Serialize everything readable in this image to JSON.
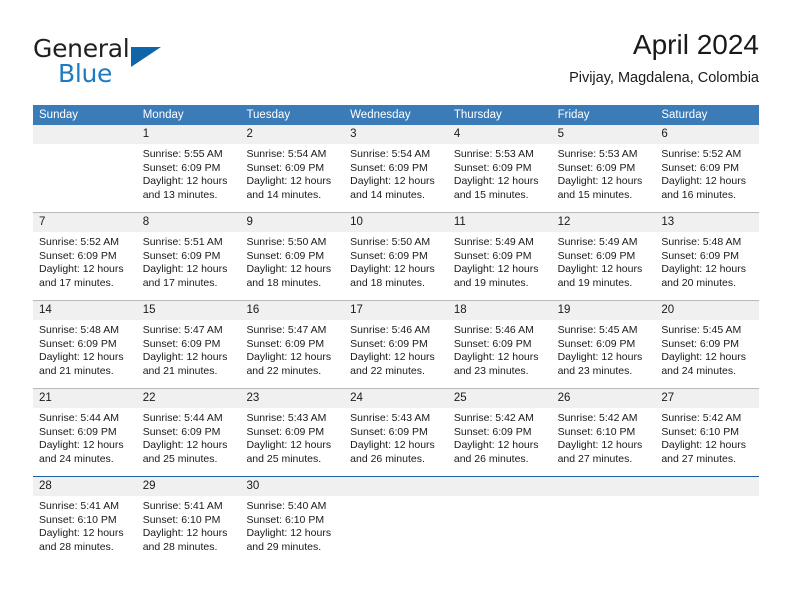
{
  "brand": {
    "word1": "General",
    "word2": "Blue",
    "triangle_icon": "triangle-icon"
  },
  "header": {
    "title": "April 2024",
    "location": "Pivijay, Magdalena, Colombia"
  },
  "colors": {
    "header_blue": "#3b7cb8",
    "brand_blue": "#1f7bc1",
    "triangle_blue": "#1065a8",
    "daynum_band": "#f0f0f0",
    "row_separator": "#b9b9b9",
    "last_separator": "#1f5fa0",
    "text": "#1a1a1a"
  },
  "weekdays": [
    "Sunday",
    "Monday",
    "Tuesday",
    "Wednesday",
    "Thursday",
    "Friday",
    "Saturday"
  ],
  "labels": {
    "sunrise": "Sunrise:",
    "sunset": "Sunset:",
    "daylight": "Daylight:"
  },
  "weeks": [
    [
      {
        "day": "",
        "sunrise": "",
        "sunset": "",
        "daylight_1": "",
        "daylight_2": ""
      },
      {
        "day": "1",
        "sunrise": "Sunrise: 5:55 AM",
        "sunset": "Sunset: 6:09 PM",
        "daylight_1": "Daylight: 12 hours",
        "daylight_2": "and 13 minutes."
      },
      {
        "day": "2",
        "sunrise": "Sunrise: 5:54 AM",
        "sunset": "Sunset: 6:09 PM",
        "daylight_1": "Daylight: 12 hours",
        "daylight_2": "and 14 minutes."
      },
      {
        "day": "3",
        "sunrise": "Sunrise: 5:54 AM",
        "sunset": "Sunset: 6:09 PM",
        "daylight_1": "Daylight: 12 hours",
        "daylight_2": "and 14 minutes."
      },
      {
        "day": "4",
        "sunrise": "Sunrise: 5:53 AM",
        "sunset": "Sunset: 6:09 PM",
        "daylight_1": "Daylight: 12 hours",
        "daylight_2": "and 15 minutes."
      },
      {
        "day": "5",
        "sunrise": "Sunrise: 5:53 AM",
        "sunset": "Sunset: 6:09 PM",
        "daylight_1": "Daylight: 12 hours",
        "daylight_2": "and 15 minutes."
      },
      {
        "day": "6",
        "sunrise": "Sunrise: 5:52 AM",
        "sunset": "Sunset: 6:09 PM",
        "daylight_1": "Daylight: 12 hours",
        "daylight_2": "and 16 minutes."
      }
    ],
    [
      {
        "day": "7",
        "sunrise": "Sunrise: 5:52 AM",
        "sunset": "Sunset: 6:09 PM",
        "daylight_1": "Daylight: 12 hours",
        "daylight_2": "and 17 minutes."
      },
      {
        "day": "8",
        "sunrise": "Sunrise: 5:51 AM",
        "sunset": "Sunset: 6:09 PM",
        "daylight_1": "Daylight: 12 hours",
        "daylight_2": "and 17 minutes."
      },
      {
        "day": "9",
        "sunrise": "Sunrise: 5:50 AM",
        "sunset": "Sunset: 6:09 PM",
        "daylight_1": "Daylight: 12 hours",
        "daylight_2": "and 18 minutes."
      },
      {
        "day": "10",
        "sunrise": "Sunrise: 5:50 AM",
        "sunset": "Sunset: 6:09 PM",
        "daylight_1": "Daylight: 12 hours",
        "daylight_2": "and 18 minutes."
      },
      {
        "day": "11",
        "sunrise": "Sunrise: 5:49 AM",
        "sunset": "Sunset: 6:09 PM",
        "daylight_1": "Daylight: 12 hours",
        "daylight_2": "and 19 minutes."
      },
      {
        "day": "12",
        "sunrise": "Sunrise: 5:49 AM",
        "sunset": "Sunset: 6:09 PM",
        "daylight_1": "Daylight: 12 hours",
        "daylight_2": "and 19 minutes."
      },
      {
        "day": "13",
        "sunrise": "Sunrise: 5:48 AM",
        "sunset": "Sunset: 6:09 PM",
        "daylight_1": "Daylight: 12 hours",
        "daylight_2": "and 20 minutes."
      }
    ],
    [
      {
        "day": "14",
        "sunrise": "Sunrise: 5:48 AM",
        "sunset": "Sunset: 6:09 PM",
        "daylight_1": "Daylight: 12 hours",
        "daylight_2": "and 21 minutes."
      },
      {
        "day": "15",
        "sunrise": "Sunrise: 5:47 AM",
        "sunset": "Sunset: 6:09 PM",
        "daylight_1": "Daylight: 12 hours",
        "daylight_2": "and 21 minutes."
      },
      {
        "day": "16",
        "sunrise": "Sunrise: 5:47 AM",
        "sunset": "Sunset: 6:09 PM",
        "daylight_1": "Daylight: 12 hours",
        "daylight_2": "and 22 minutes."
      },
      {
        "day": "17",
        "sunrise": "Sunrise: 5:46 AM",
        "sunset": "Sunset: 6:09 PM",
        "daylight_1": "Daylight: 12 hours",
        "daylight_2": "and 22 minutes."
      },
      {
        "day": "18",
        "sunrise": "Sunrise: 5:46 AM",
        "sunset": "Sunset: 6:09 PM",
        "daylight_1": "Daylight: 12 hours",
        "daylight_2": "and 23 minutes."
      },
      {
        "day": "19",
        "sunrise": "Sunrise: 5:45 AM",
        "sunset": "Sunset: 6:09 PM",
        "daylight_1": "Daylight: 12 hours",
        "daylight_2": "and 23 minutes."
      },
      {
        "day": "20",
        "sunrise": "Sunrise: 5:45 AM",
        "sunset": "Sunset: 6:09 PM",
        "daylight_1": "Daylight: 12 hours",
        "daylight_2": "and 24 minutes."
      }
    ],
    [
      {
        "day": "21",
        "sunrise": "Sunrise: 5:44 AM",
        "sunset": "Sunset: 6:09 PM",
        "daylight_1": "Daylight: 12 hours",
        "daylight_2": "and 24 minutes."
      },
      {
        "day": "22",
        "sunrise": "Sunrise: 5:44 AM",
        "sunset": "Sunset: 6:09 PM",
        "daylight_1": "Daylight: 12 hours",
        "daylight_2": "and 25 minutes."
      },
      {
        "day": "23",
        "sunrise": "Sunrise: 5:43 AM",
        "sunset": "Sunset: 6:09 PM",
        "daylight_1": "Daylight: 12 hours",
        "daylight_2": "and 25 minutes."
      },
      {
        "day": "24",
        "sunrise": "Sunrise: 5:43 AM",
        "sunset": "Sunset: 6:09 PM",
        "daylight_1": "Daylight: 12 hours",
        "daylight_2": "and 26 minutes."
      },
      {
        "day": "25",
        "sunrise": "Sunrise: 5:42 AM",
        "sunset": "Sunset: 6:09 PM",
        "daylight_1": "Daylight: 12 hours",
        "daylight_2": "and 26 minutes."
      },
      {
        "day": "26",
        "sunrise": "Sunrise: 5:42 AM",
        "sunset": "Sunset: 6:10 PM",
        "daylight_1": "Daylight: 12 hours",
        "daylight_2": "and 27 minutes."
      },
      {
        "day": "27",
        "sunrise": "Sunrise: 5:42 AM",
        "sunset": "Sunset: 6:10 PM",
        "daylight_1": "Daylight: 12 hours",
        "daylight_2": "and 27 minutes."
      }
    ],
    [
      {
        "day": "28",
        "sunrise": "Sunrise: 5:41 AM",
        "sunset": "Sunset: 6:10 PM",
        "daylight_1": "Daylight: 12 hours",
        "daylight_2": "and 28 minutes."
      },
      {
        "day": "29",
        "sunrise": "Sunrise: 5:41 AM",
        "sunset": "Sunset: 6:10 PM",
        "daylight_1": "Daylight: 12 hours",
        "daylight_2": "and 28 minutes."
      },
      {
        "day": "30",
        "sunrise": "Sunrise: 5:40 AM",
        "sunset": "Sunset: 6:10 PM",
        "daylight_1": "Daylight: 12 hours",
        "daylight_2": "and 29 minutes."
      },
      {
        "day": "",
        "sunrise": "",
        "sunset": "",
        "daylight_1": "",
        "daylight_2": ""
      },
      {
        "day": "",
        "sunrise": "",
        "sunset": "",
        "daylight_1": "",
        "daylight_2": ""
      },
      {
        "day": "",
        "sunrise": "",
        "sunset": "",
        "daylight_1": "",
        "daylight_2": ""
      },
      {
        "day": "",
        "sunrise": "",
        "sunset": "",
        "daylight_1": "",
        "daylight_2": ""
      }
    ]
  ]
}
